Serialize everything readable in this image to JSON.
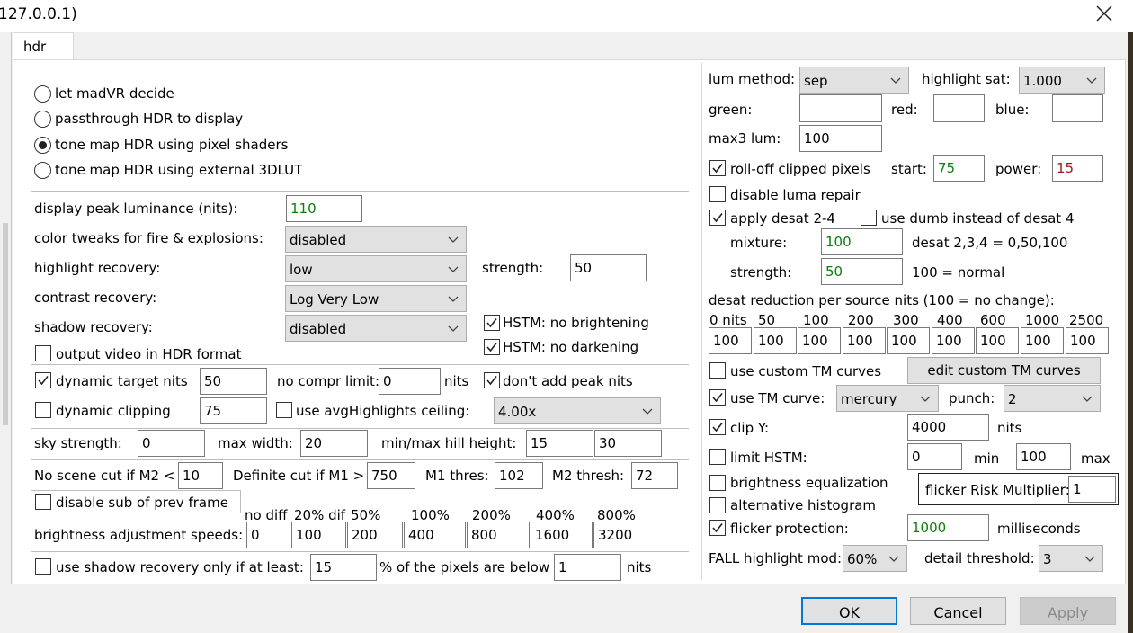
{
  "window": {
    "title": "127.0.0.1)"
  },
  "tabs": [
    "hdr"
  ],
  "left": {
    "modes": [
      {
        "label": "let madVR decide",
        "selected": false
      },
      {
        "label": "passthrough HDR to display",
        "selected": false
      },
      {
        "label": "tone map HDR using pixel shaders",
        "selected": true
      },
      {
        "label": "tone map HDR using external 3DLUT",
        "selected": false
      }
    ],
    "display_peak_label": "display peak luminance (nits):",
    "display_peak_value": "110",
    "color_tweaks_label": "color tweaks for fire & explosions:",
    "color_tweaks_value": "disabled",
    "highlight_recovery_label": "highlight recovery:",
    "highlight_recovery_value": "low",
    "strength_label": "strength:",
    "strength_value": "50",
    "contrast_recovery_label": "contrast recovery:",
    "contrast_recovery_value": "Log Very Low",
    "shadow_recovery_label": "shadow recovery:",
    "shadow_recovery_value": "disabled",
    "hstm_no_brightening": "HSTM: no brightening",
    "hstm_no_darkening": "HSTM: no darkening",
    "output_hdr": "output video in HDR format",
    "dynamic_target_label": "dynamic target nits",
    "dynamic_target_value": "50",
    "no_compr_label": "no compr limit:",
    "no_compr_value": "0",
    "nits_label": "nits",
    "dont_add_peak": "don't add peak nits",
    "dynamic_clipping_label": "dynamic clipping",
    "dynamic_clipping_value": "75",
    "avg_highlights_label": "use avgHighlights ceiling:",
    "avg_highlights_value": "4.00x",
    "sky_strength_label": "sky strength:",
    "sky_strength_value": "0",
    "max_width_label": "max width:",
    "max_width_value": "20",
    "hill_label": "min/max hill height:",
    "hill_min": "15",
    "hill_max": "30",
    "no_scene_cut_label": "No scene cut if M2 <",
    "no_scene_cut_value": "10",
    "definite_cut_label": "Definite cut if M1 >",
    "definite_cut_value": "750",
    "m1_thres_label": "M1 thres:",
    "m1_thres_value": "102",
    "m2_thresh_label": "M2 thresh:",
    "m2_thresh_value": "72",
    "disable_sub_label": "disable sub of prev frame",
    "speed_headers": [
      "no diff",
      "20% dif",
      "50%",
      "100%",
      "200%",
      "400%",
      "800%"
    ],
    "speeds_label": "brightness adjustment speeds:",
    "speed_values": [
      "0",
      "100",
      "200",
      "400",
      "800",
      "1600",
      "3200"
    ],
    "shadow_only_label": "use shadow recovery only if at least:",
    "shadow_only_value": "15",
    "pixels_below_label": "% of the pixels are below",
    "pixels_below_value": "1",
    "pixels_nits_label": "nits"
  },
  "right": {
    "lum_method_label": "lum method:",
    "lum_method_value": "sep",
    "highlight_sat_label": "highlight sat:",
    "highlight_sat_value": "1.000",
    "green_label": "green:",
    "red_label": "red:",
    "blue_label": "blue:",
    "max3_label": "max3 lum:",
    "max3_value": "100",
    "rolloff_label": "roll-off clipped pixels",
    "start_label": "start:",
    "start_value": "75",
    "power_label": "power:",
    "power_value": "15",
    "disable_luma_label": "disable luma repair",
    "apply_desat_label": "apply desat 2-4",
    "dumb_desat_label": "use dumb instead of desat 4",
    "mixture_label": "mixture:",
    "mixture_value": "100",
    "mixture_note": "desat 2,3,4 = 0,50,100",
    "desat_strength_label": "strength:",
    "desat_strength_value": "50",
    "desat_strength_note": "100 = normal",
    "desat_reduction_label": "desat reduction per source nits (100 = no change):",
    "nits_headers": [
      "0 nits",
      "50",
      "100",
      "200",
      "300",
      "400",
      "600",
      "1000",
      "2500"
    ],
    "nits_values": [
      "100",
      "100",
      "100",
      "100",
      "100",
      "100",
      "100",
      "100",
      "100"
    ],
    "custom_tm_label": "use custom TM curves",
    "edit_custom_tm": "edit custom TM curves",
    "tm_curve_label": "use TM curve:",
    "tm_curve_value": "mercury",
    "punch_label": "punch:",
    "punch_value": "2",
    "clip_y_label": "clip Y:",
    "clip_y_value": "4000",
    "clip_y_unit": "nits",
    "limit_hstm_label": "limit HSTM:",
    "limit_min_value": "0",
    "limit_min_label": "min",
    "limit_max_value": "100",
    "limit_max_label": "max",
    "brightness_eq_label": "brightness equalization",
    "alt_histogram_label": "alternative histogram",
    "flicker_risk_label": "flicker Risk Multiplier:",
    "flicker_risk_value": "1",
    "flicker_protection_label": "flicker protection:",
    "flicker_protection_value": "1000",
    "milliseconds_label": "milliseconds",
    "fall_label": "FALL highlight mod:",
    "fall_value": "60%",
    "detail_label": "detail threshold:",
    "detail_value": "3"
  },
  "buttons": {
    "ok": "OK",
    "cancel": "Cancel",
    "apply": "Apply"
  }
}
